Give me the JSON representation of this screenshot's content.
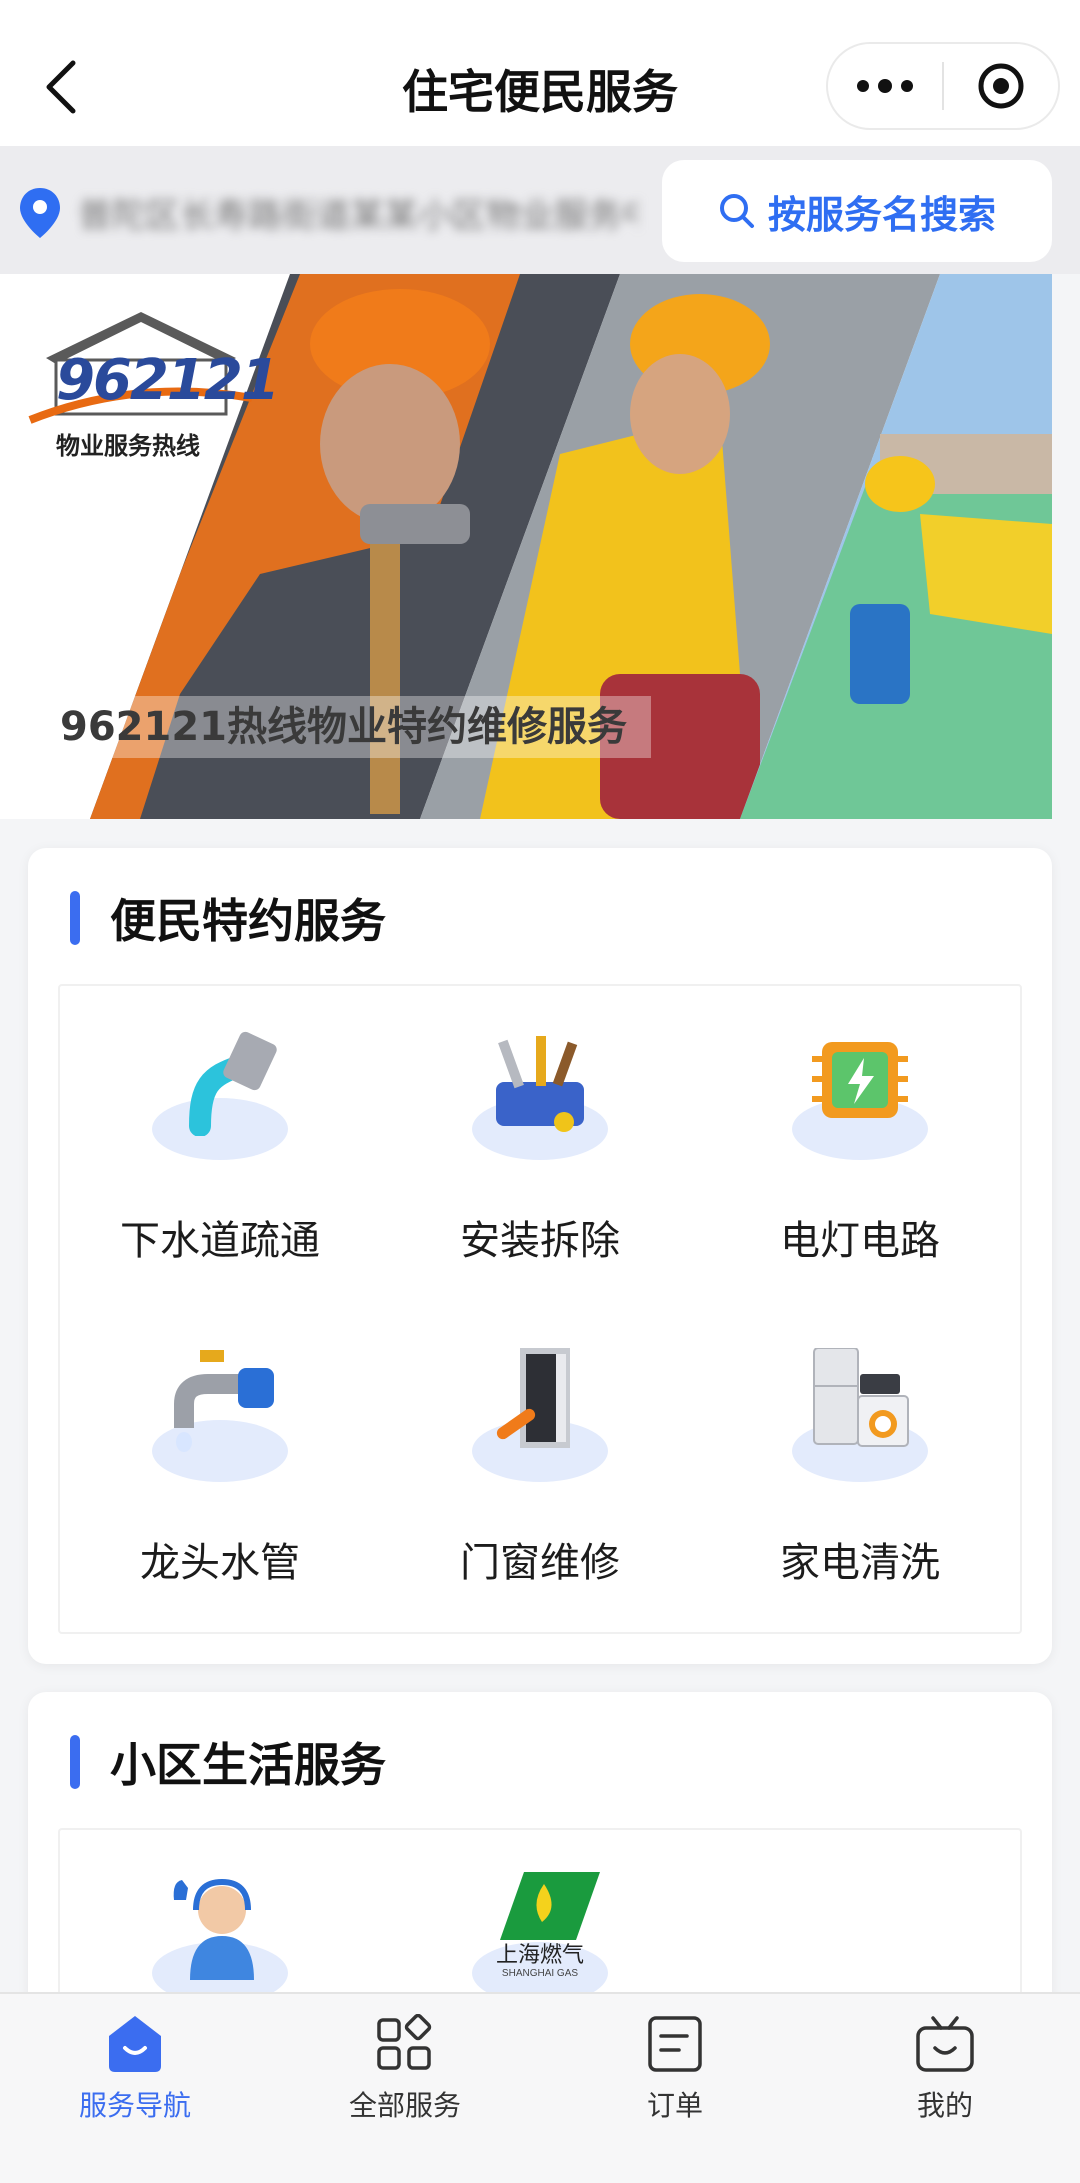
{
  "header": {
    "title": "住宅便民服务"
  },
  "location": {
    "address": "普陀区长寿路街道某某小区物业服务中心地址",
    "search_label": "按服务名搜索"
  },
  "banner": {
    "logo_number": "962121",
    "logo_subtitle": "物业服务热线",
    "caption": "962121热线物业特约维修服务"
  },
  "section1": {
    "title": "便民特约服务",
    "items": [
      {
        "label": "下水道疏通",
        "icon": "drain-pipe-icon"
      },
      {
        "label": "安装拆除",
        "icon": "toolbox-icon"
      },
      {
        "label": "电灯电路",
        "icon": "circuit-chip-icon"
      },
      {
        "label": "龙头水管",
        "icon": "faucet-icon"
      },
      {
        "label": "门窗维修",
        "icon": "door-screwdriver-icon"
      },
      {
        "label": "家电清洗",
        "icon": "appliances-icon"
      }
    ]
  },
  "section2": {
    "title": "小区生活服务",
    "items": [
      {
        "label": "",
        "icon": "customer-service-icon"
      },
      {
        "label": "",
        "icon": "shanghai-gas-logo",
        "logo_text": "上海燃气",
        "logo_sub": "SHANGHAI GAS"
      }
    ]
  },
  "tabbar": {
    "items": [
      {
        "label": "服务导航",
        "icon": "home-smile-icon",
        "active": true
      },
      {
        "label": "全部服务",
        "icon": "grid-apps-icon",
        "active": false
      },
      {
        "label": "订单",
        "icon": "order-list-icon",
        "active": false
      },
      {
        "label": "我的",
        "icon": "tv-smile-icon",
        "active": false
      }
    ]
  },
  "colors": {
    "accent": "#3b6df0",
    "background": "#f4f5f7"
  }
}
